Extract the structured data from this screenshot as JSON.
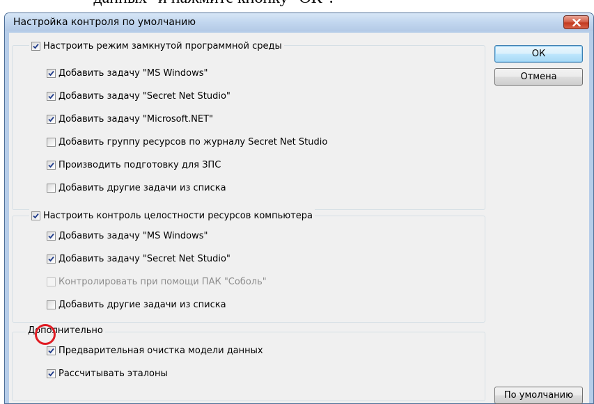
{
  "document": {
    "caption_fragment": "данных\" и нажмите кнопку \"ОК\"."
  },
  "dialog": {
    "title": "Настройка контроля по умолчанию",
    "close_icon": "close-icon",
    "accent_colors": {
      "title_bar": "#c2d7ef",
      "close_button": "#c33a1f",
      "highlight": "#e01b22"
    },
    "group1": {
      "label": "Настроить режим замкнутой программной среды",
      "checked": true,
      "items": [
        {
          "label": "Добавить задачу \"MS Windows\"",
          "checked": true
        },
        {
          "label": "Добавить задачу \"Secret Net Studio\"",
          "checked": true
        },
        {
          "label": "Добавить задачу \"Microsoft.NET\"",
          "checked": true
        },
        {
          "label": "Добавить группу ресурсов по журналу Secret Net Studio",
          "checked": false
        },
        {
          "label": "Производить подготовку для ЗПС",
          "checked": true
        },
        {
          "label": "Добавить другие задачи из списка",
          "checked": false
        }
      ]
    },
    "group2": {
      "label": "Настроить контроль целостности ресурсов компьютера",
      "checked": true,
      "items": [
        {
          "label": "Добавить задачу \"MS Windows\"",
          "checked": true
        },
        {
          "label": "Добавить задачу \"Secret Net Studio\"",
          "checked": true
        },
        {
          "label": "Контролировать при помощи ПАК \"Соболь\"",
          "checked": false,
          "disabled": true
        },
        {
          "label": "Добавить другие задачи из списка",
          "checked": false
        }
      ]
    },
    "group3": {
      "title": "Дополнительно",
      "items": [
        {
          "label": "Предварительная очистка модели данных",
          "checked": true
        },
        {
          "label": "Рассчитывать эталоны",
          "checked": true
        }
      ]
    },
    "buttons": {
      "ok": "ОК",
      "cancel": "Отмена",
      "defaults": "По умолчанию"
    }
  }
}
